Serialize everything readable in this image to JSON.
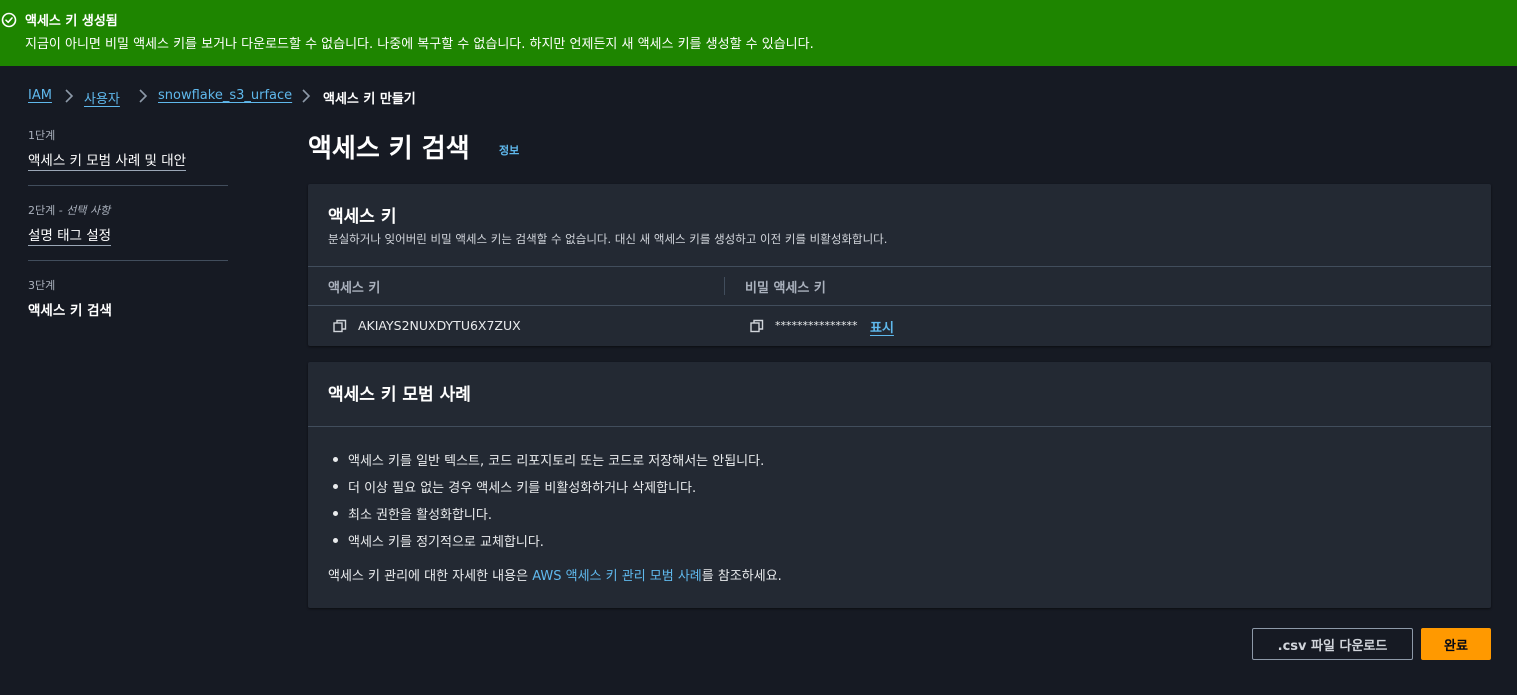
{
  "banner": {
    "title": "액세스 키 생성됨",
    "message": "지금이 아니면 비밀 액세스 키를 보거나 다운로드할 수 없습니다. 나중에 복구할 수 없습니다. 하지만 언제든지 새 액세스 키를 생성할 수 있습니다.",
    "icon": "check-circle-icon",
    "color": "#1e8500"
  },
  "breadcrumb": {
    "items": [
      "IAM",
      "사용자",
      "snowflake_s3_urface"
    ],
    "current": "액세스 키 만들기"
  },
  "steps": [
    {
      "num": "1단계",
      "optional": "",
      "title": "액세스 키 모범 사례 및 대안"
    },
    {
      "num": "2단계",
      "optional": "- 선택 사항",
      "title": "설명 태그 설정"
    },
    {
      "num": "3단계",
      "optional": "",
      "title": "액세스 키 검색"
    }
  ],
  "page": {
    "title": "액세스 키 검색",
    "info": "정보"
  },
  "access_key_panel": {
    "title": "액세스 키",
    "description": "분실하거나 잊어버린 비밀 액세스 키는 검색할 수 없습니다. 대신 새 액세스 키를 생성하고 이전 키를 비활성화합니다.",
    "col_access_key": "액세스 키",
    "col_secret_key": "비밀 액세스 키",
    "access_key_value": "AKIAYS2NUXDYTU6X7ZUX",
    "secret_key_masked": "***************",
    "show_label": "표시"
  },
  "best_practices": {
    "title": "액세스 키 모범 사례",
    "items": [
      "액세스 키를 일반 텍스트, 코드 리포지토리 또는 코드로 저장해서는 안됩니다.",
      "더 이상 필요 없는 경우 액세스 키를 비활성화하거나 삭제합니다.",
      "최소 권한을 활성화합니다.",
      "액세스 키를 정기적으로 교체합니다."
    ],
    "ref_prefix": "액세스 키 관리에 대한 자세한 내용은 ",
    "ref_link": "AWS 액세스 키 관리 모범 사례",
    "ref_suffix": "를 참조하세요."
  },
  "buttons": {
    "download_csv": ".csv 파일 다운로드",
    "done": "완료"
  },
  "colors": {
    "accent": "#ff9900",
    "link": "#5fb8ec",
    "background": "#161a23",
    "panel": "#232933"
  }
}
